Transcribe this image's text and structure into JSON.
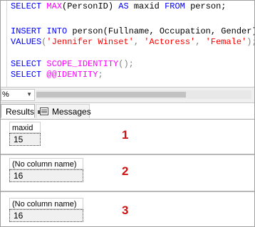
{
  "editor": {
    "line1": {
      "kw1": "SELECT ",
      "fn": "MAX",
      "rest": "(PersonID) ",
      "kw2": "AS",
      "rest2": " maxid ",
      "kw3": "FROM",
      "rest3": " person;"
    },
    "line3": {
      "kw1": "INSERT INTO",
      "rest": " person(Fullname, Occupation, Gender)"
    },
    "line4": {
      "kw1": "VALUES",
      "p1": "(",
      "s1": "'Jennifer Winset'",
      "c1": ", ",
      "s2": "'Actoress'",
      "c2": ", ",
      "s3": "'Female'",
      "end": ");"
    },
    "line6": {
      "kw1": "SELECT ",
      "fn": "SCOPE_IDENTITY",
      "end": "();"
    },
    "line7": {
      "kw1": "SELECT ",
      "fn": "@@IDENTITY",
      "end": ";"
    }
  },
  "zoom": {
    "value": "%"
  },
  "tabs": {
    "results": "Results",
    "messages": "Messages"
  },
  "results": [
    {
      "header": "maxid",
      "value": "15",
      "annotation": "1"
    },
    {
      "header": "(No column name)",
      "value": "16",
      "annotation": "2"
    },
    {
      "header": "(No column name)",
      "value": "16",
      "annotation": "3"
    }
  ],
  "colors": {
    "keyword": "#0000ff",
    "function": "#ff00ff",
    "string": "#ff0000",
    "annotation": "#cc1111"
  }
}
